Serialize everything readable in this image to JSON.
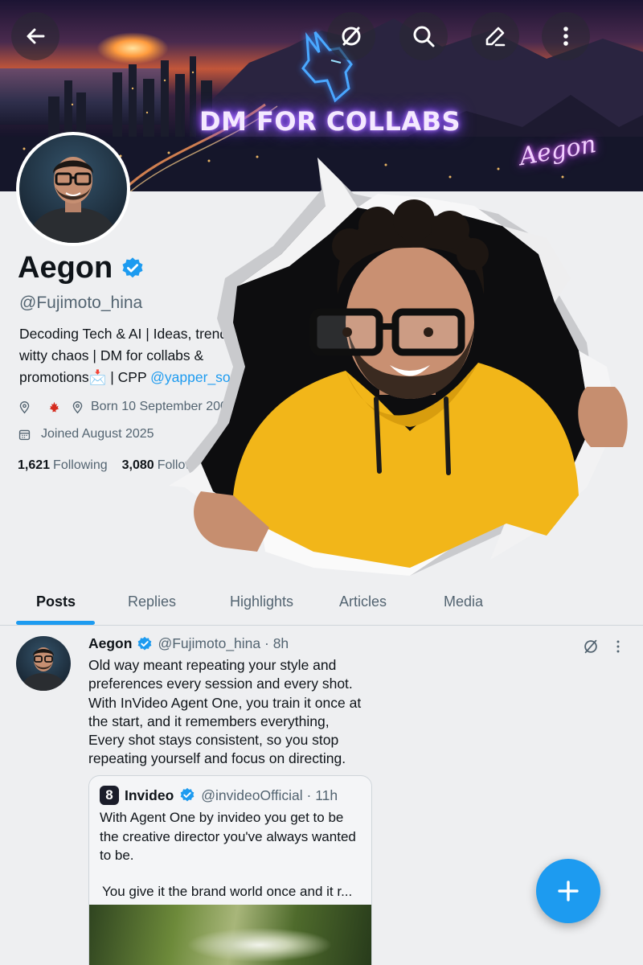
{
  "banner": {
    "headline": "DM FOR COLLABS",
    "signature": "Aegon"
  },
  "topbar": {
    "back_icon": "arrow-left-icon",
    "grok_icon": "slash-circle-icon",
    "search_icon": "search-icon",
    "edit_icon": "edit-icon",
    "more_icon": "more-vertical-icon"
  },
  "profile": {
    "name": "Aegon",
    "handle": "@Fujimoto_hina",
    "bio_text": "Decoding Tech & AI | Ideas, trends & witty chaos | DM for collabs & promotions📩 | CPP ",
    "bio_link": "@yapper_so",
    "born": "Born 10 September 2002",
    "joined": "Joined August 2025",
    "following_count": "1,621",
    "following_label": "Following",
    "followers_count": "3,080",
    "followers_label": "Followers"
  },
  "tabs": [
    "Posts",
    "Replies",
    "Highlights",
    "Articles",
    "Media"
  ],
  "post": {
    "author": "Aegon",
    "handle_time": "@Fujimoto_hina · 8h",
    "text": "Old way meant repeating your style and preferences every session and every shot. With InVideo Agent One, you train it once at the start, and it remembers everything, Every shot stays consistent, so you stop repeating yourself and focus on directing.",
    "quote": {
      "logo": "8",
      "author": "Invideo",
      "handle_time": "@invideoOfficial · 11h",
      "text": "With Agent One by invideo you get to be the creative director you've always wanted to be.",
      "text2": "You give it the brand world once and it r..."
    }
  },
  "colors": {
    "accent": "#1d9bf0",
    "text_primary": "#0f1419",
    "text_secondary": "#536471",
    "hoodie": "#f2b619"
  }
}
